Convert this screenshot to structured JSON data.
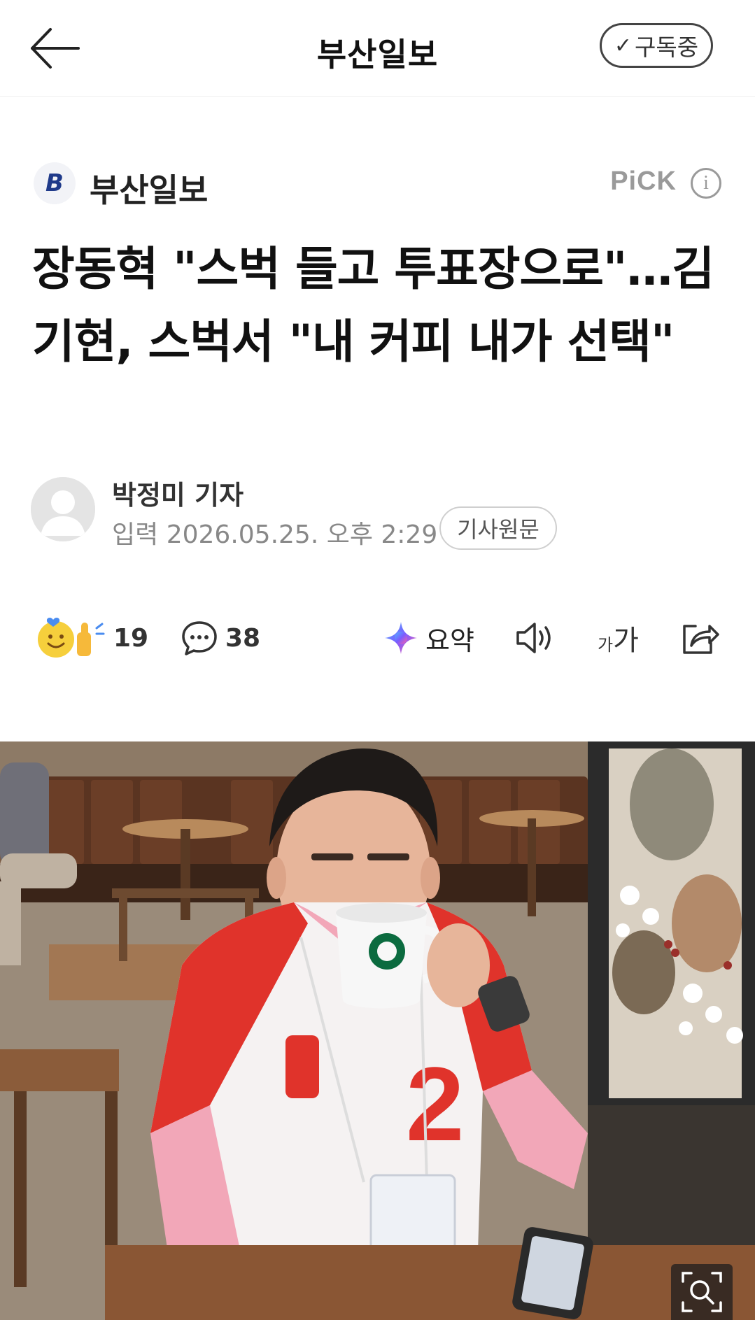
{
  "topbar": {
    "title": "부산일보",
    "subscribe_label": "구독중"
  },
  "press": {
    "logo_letter": "B",
    "name": "부산일보",
    "pick_label": "PiCK",
    "info_glyph": "i"
  },
  "article": {
    "headline": "장동혁 \"스벅 들고 투표장으로\"…김기현, 스벅서 \"내 커피 내가 선택\"",
    "author": "박정미 기자",
    "published_label": "입력",
    "published_datetime": "2026.05.25. 오후 2:29",
    "original_button": "기사원문"
  },
  "actions": {
    "reaction_count": "19",
    "comment_count": "38",
    "summary_label": "요약",
    "font_size_small": "가",
    "font_size_large": "가"
  },
  "photo": {
    "alt": "",
    "colors": {
      "jersey_red": "#e0332b",
      "shirt_pink": "#f2a7b8",
      "wall_brown": "#6b4a33"
    }
  },
  "icons": [
    "arrow-left-icon",
    "check-icon",
    "info-icon",
    "avatar-icon",
    "reaction-emoji-icon",
    "comment-icon",
    "sparkle-icon",
    "speaker-icon",
    "font-size-icon",
    "share-icon",
    "zoom-icon"
  ]
}
